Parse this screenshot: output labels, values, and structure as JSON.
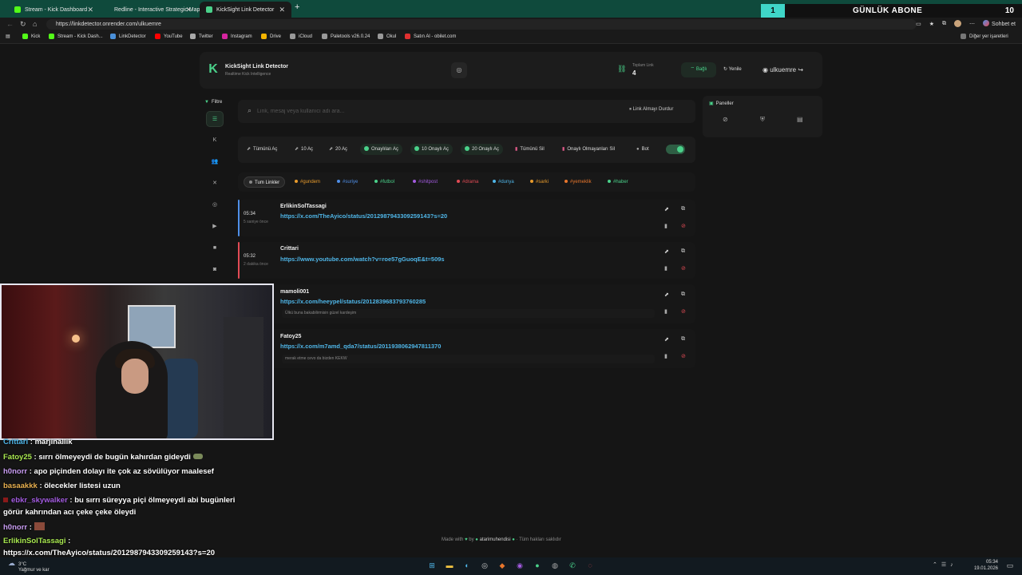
{
  "browser": {
    "tabs": [
      {
        "label": "Stream - Kick Dashboard",
        "color": "#53fc18"
      },
      {
        "label": "Redline - Interactive Strategic Map",
        "color": "#cc2b2b"
      },
      {
        "label": "KickSight Link Detector",
        "color": "#4ad18a"
      }
    ],
    "new_tab": "+",
    "url": "https://linkdetector.onrender.com/ulkuemre",
    "chat_label": "Sohbet et",
    "bookmarks": [
      {
        "label": "Kick",
        "color": "#53fc18"
      },
      {
        "label": "Stream - Kick Dash...",
        "color": "#53fc18"
      },
      {
        "label": "LinkDetector",
        "color": "#4a90d9"
      },
      {
        "label": "YouTube",
        "color": "#ff0000"
      },
      {
        "label": "Twitter",
        "color": "#aaaaaa"
      },
      {
        "label": "Instagram",
        "color": "#d6249f"
      },
      {
        "label": "Drive",
        "color": "#f4b400"
      },
      {
        "label": "iCloud",
        "color": "#999999"
      },
      {
        "label": "Paletools v26.0.24",
        "color": "#999999"
      },
      {
        "label": "Okul",
        "color": "#999999"
      },
      {
        "label": "Satın Al - obilet.com",
        "color": "#e03030"
      }
    ],
    "other_bookmarks": "Diğer yer işaretleri"
  },
  "banner": {
    "number": "1",
    "text": "GÜNLÜK ABONE",
    "count": "10"
  },
  "header": {
    "title": "KickSight Link Detector",
    "subtitle": "Realtime Kick Intelligence",
    "total_label": "Toplam Link",
    "total_value": "4",
    "connected_label": "Bağlı",
    "refresh_label": "Yenile",
    "username": "ulkuemre"
  },
  "filter_label": "Filtre",
  "search": {
    "placeholder": "Link, mesaj veya kullanıcı adı ara...",
    "stop_label": "Link Almayı Durdur"
  },
  "panels_title": "Paneller",
  "actions": {
    "open_all": "Tümünü Aç",
    "open_10": "10 Aç",
    "open_20": "20 Aç",
    "open_approved": "Onaylıları Aç",
    "open_10_approved": "10 Onaylı Aç",
    "open_20_approved": "20 Onaylı Aç",
    "delete_all": "Tümünü Sil",
    "delete_unapproved": "Onaylı Olmayanları Sil",
    "bot": "Bot"
  },
  "tags": [
    {
      "label": "Tum Linkler",
      "color": "#888888"
    },
    {
      "label": "#gundem",
      "color": "#e89b2c"
    },
    {
      "label": "#suriye",
      "color": "#4f8fe8"
    },
    {
      "label": "#futbol",
      "color": "#4ad18a"
    },
    {
      "label": "#shitpost",
      "color": "#a35be0"
    },
    {
      "label": "#drama",
      "color": "#e24b55"
    },
    {
      "label": "#dunya",
      "color": "#4fb6e8"
    },
    {
      "label": "#sarki",
      "color": "#e89b2c"
    },
    {
      "label": "#yemeklik",
      "color": "#e8762c"
    },
    {
      "label": "#haber",
      "color": "#4ad18a"
    }
  ],
  "links": [
    {
      "time": "05:34",
      "ago": "5 saniye önce",
      "user": "ErlikinSolTassagi",
      "url": "https://x.com/TheAyico/status/2012987943309259143?s=20",
      "message": "",
      "bar": "#4f8fe8"
    },
    {
      "time": "05:32",
      "ago": "2 dakika önce",
      "user": "Crittari",
      "url": "https://www.youtube.com/watch?v=roe57gGuoqE&t=509s",
      "message": "",
      "bar": "#e24b55"
    },
    {
      "time": "",
      "ago": "",
      "user": "mamoli001",
      "url": "https://x.com/heeypel/status/2012839683793760285",
      "message": "Ülkü buna bakabilirmisin güzel kardeşim",
      "bar": "#4f8fe8"
    },
    {
      "time": "",
      "ago": "",
      "user": "Fatoy25",
      "url": "https://x.com/m7amd_qda7/status/2011938062947811370",
      "message": "merak etme cevo da bizden KEKW",
      "bar": "#4f8fe8"
    }
  ],
  "footer": {
    "made_with": "Made with",
    "by": "by",
    "author": "atarimuhendisi",
    "rights": "· Tüm hakları saklıdır"
  },
  "chat": [
    {
      "user": "Crittari",
      "color": "#4fb6e8",
      "text": ": marjinallik"
    },
    {
      "user": "Fatoy25",
      "color": "#a8e84f",
      "text": ": sırrı ölmeyeydi de bugün kahırdan gideydi"
    },
    {
      "user": "h0norr",
      "color": "#c79bf0",
      "text": ": apo piçinden dolayı ite çok az sövülüyor maalesef"
    },
    {
      "user": "basaakkk",
      "color": "#e8b04f",
      "text": ": ölecekler listesi uzun"
    },
    {
      "user": "ebkr_skywalker",
      "color": "#a35be0",
      "text": ": bu sırrı süreyya piçi ölmeyeydi abi bugünleri"
    },
    {
      "user": "",
      "color": "#ffffff",
      "text": "görür kahrından acı çeke çeke öleydi"
    },
    {
      "user": "h0norr",
      "color": "#c79bf0",
      "text": ":"
    },
    {
      "user": "ErlikinSolTassagi",
      "color": "#a8e84f",
      "text": ":"
    },
    {
      "user": "",
      "color": "#ffffff",
      "text": "https://x.com/TheAyico/status/2012987943309259143?s=20"
    }
  ],
  "taskbar": {
    "temp": "3°C",
    "weather": "Yağmur ve kar",
    "time": "05:34",
    "date": "19.01.2026"
  }
}
